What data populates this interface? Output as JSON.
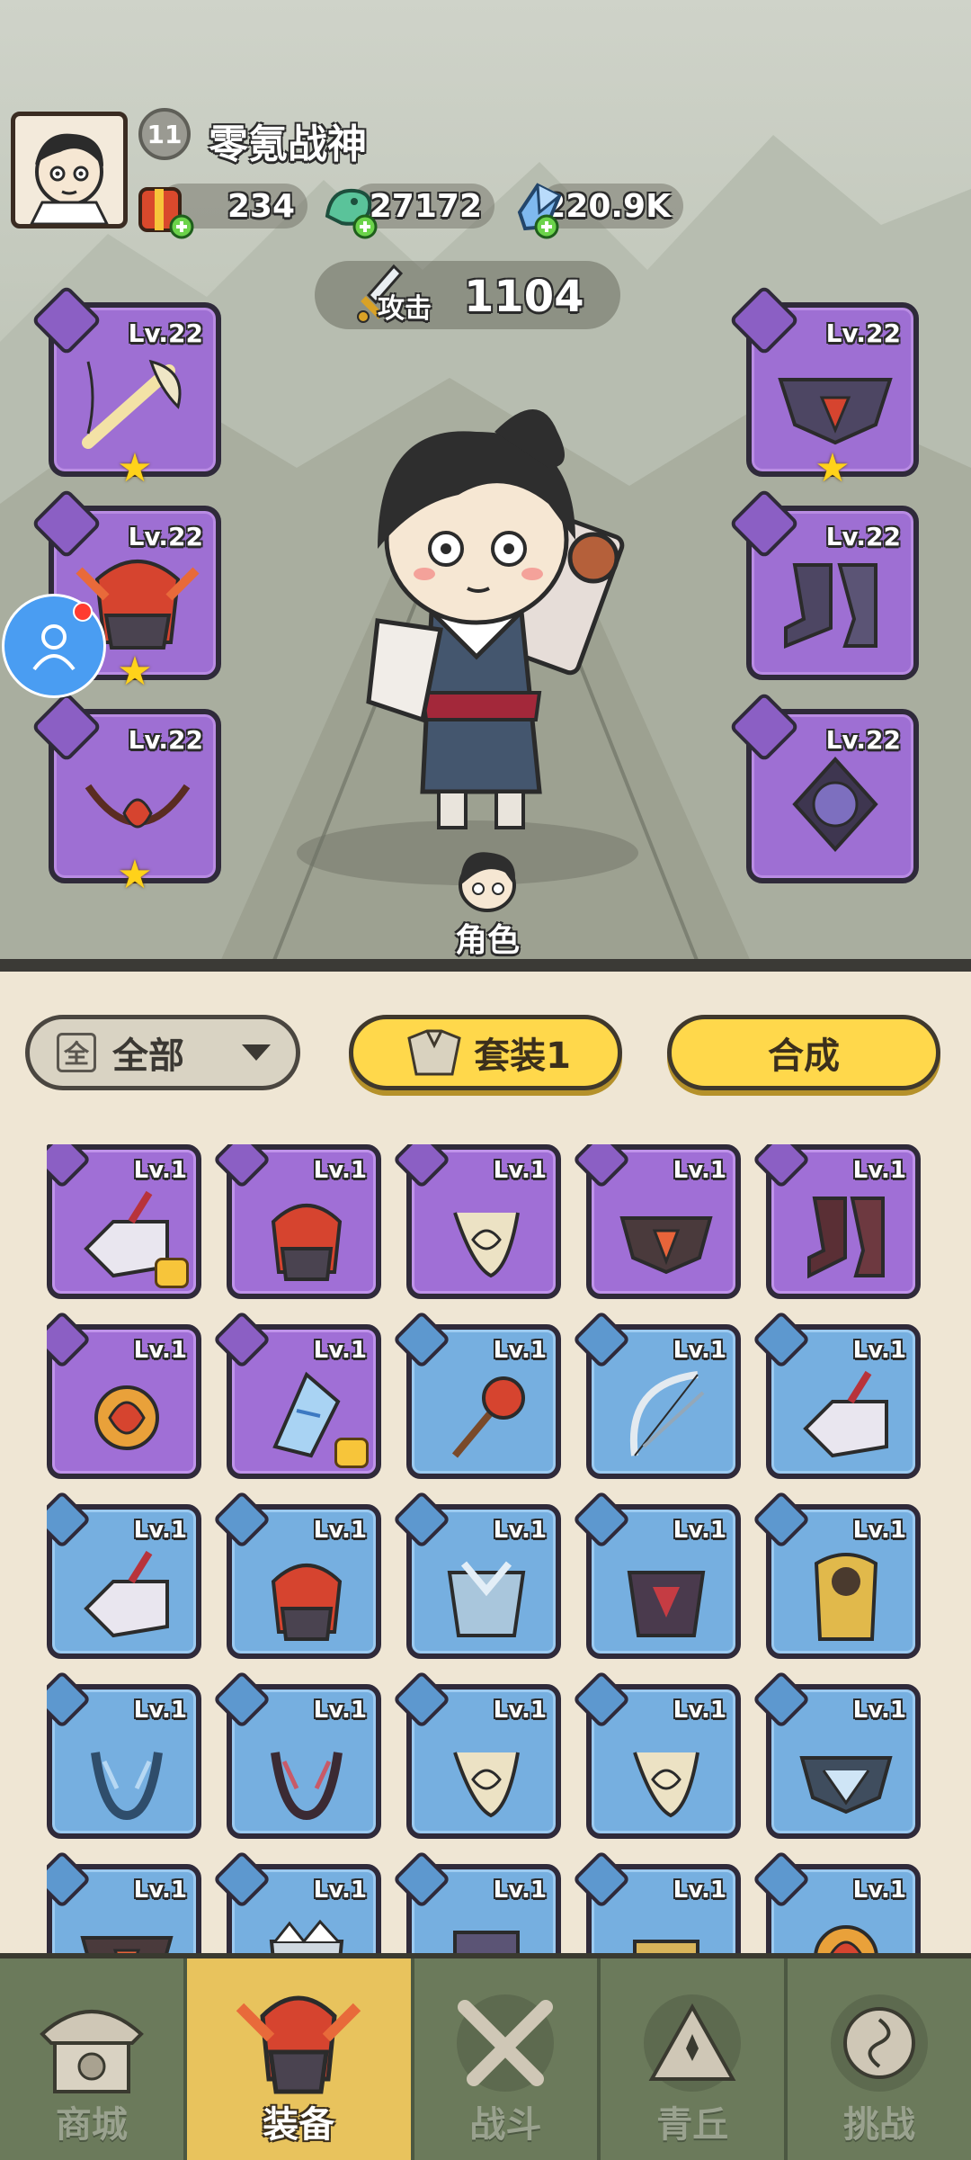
{
  "player": {
    "level": "11",
    "name": "零氪战神"
  },
  "resources": [
    {
      "name": "gift-pack",
      "value": "234"
    },
    {
      "name": "jade-dragon",
      "value": "27172"
    },
    {
      "name": "crystal",
      "value": "220.9K"
    }
  ],
  "power": {
    "label": "攻击",
    "value": "1104"
  },
  "equipped_left": [
    {
      "slot": "weapon",
      "level": "Lv.22",
      "star": "★"
    },
    {
      "slot": "helmet",
      "level": "Lv.22",
      "star": "★"
    },
    {
      "slot": "necklace",
      "level": "Lv.22",
      "star": "★"
    }
  ],
  "equipped_right": [
    {
      "slot": "belt",
      "level": "Lv.22",
      "star": "★"
    },
    {
      "slot": "boots",
      "level": "Lv.22",
      "star": ""
    },
    {
      "slot": "ring",
      "level": "Lv.22",
      "star": ""
    }
  ],
  "role_label": "角色",
  "filter": {
    "icon": "全",
    "label": "全部"
  },
  "set_button": "套装1",
  "craft_button": "合成",
  "inventory": [
    {
      "rarity": "purple",
      "level": "Lv.1",
      "item": "bracer",
      "mark": true
    },
    {
      "rarity": "purple",
      "level": "Lv.1",
      "item": "helmet",
      "mark": false
    },
    {
      "rarity": "purple",
      "level": "Lv.1",
      "item": "necklace",
      "mark": false
    },
    {
      "rarity": "purple",
      "level": "Lv.1",
      "item": "belt",
      "mark": false
    },
    {
      "rarity": "purple",
      "level": "Lv.1",
      "item": "boots",
      "mark": false
    },
    {
      "rarity": "purple",
      "level": "Lv.1",
      "item": "ring",
      "mark": false
    },
    {
      "rarity": "purple",
      "level": "Lv.1",
      "item": "pendant",
      "mark": true
    },
    {
      "rarity": "blue",
      "level": "Lv.1",
      "item": "weapon-mace",
      "mark": false
    },
    {
      "rarity": "blue",
      "level": "Lv.1",
      "item": "weapon-bow",
      "mark": false
    },
    {
      "rarity": "blue",
      "level": "Lv.1",
      "item": "bracer",
      "mark": false
    },
    {
      "rarity": "blue",
      "level": "Lv.1",
      "item": "bracer",
      "mark": false
    },
    {
      "rarity": "blue",
      "level": "Lv.1",
      "item": "helmet",
      "mark": false
    },
    {
      "rarity": "blue",
      "level": "Lv.1",
      "item": "armor-ice",
      "mark": false
    },
    {
      "rarity": "blue",
      "level": "Lv.1",
      "item": "armor-dark",
      "mark": false
    },
    {
      "rarity": "blue",
      "level": "Lv.1",
      "item": "armor-gold",
      "mark": false
    },
    {
      "rarity": "blue",
      "level": "Lv.1",
      "item": "necklace-ice",
      "mark": false
    },
    {
      "rarity": "blue",
      "level": "Lv.1",
      "item": "necklace-dark",
      "mark": false
    },
    {
      "rarity": "blue",
      "level": "Lv.1",
      "item": "necklace",
      "mark": false
    },
    {
      "rarity": "blue",
      "level": "Lv.1",
      "item": "necklace",
      "mark": false
    },
    {
      "rarity": "blue",
      "level": "Lv.1",
      "item": "belt-ice",
      "mark": false
    },
    {
      "rarity": "blue",
      "level": "Lv.1",
      "item": "belt",
      "mark": false
    },
    {
      "rarity": "blue",
      "level": "Lv.1",
      "item": "boots-ice",
      "mark": false
    },
    {
      "rarity": "blue",
      "level": "Lv.1",
      "item": "boots-dark",
      "mark": false
    },
    {
      "rarity": "blue",
      "level": "Lv.1",
      "item": "boots-gold",
      "mark": false
    },
    {
      "rarity": "blue",
      "level": "Lv.1",
      "item": "ring",
      "mark": false
    }
  ],
  "nav": [
    {
      "label": "商城",
      "icon": "shop-icon",
      "active": false
    },
    {
      "label": "装备",
      "icon": "equipment-icon",
      "active": true
    },
    {
      "label": "战斗",
      "icon": "battle-icon",
      "active": false
    },
    {
      "label": "青丘",
      "icon": "mountain-icon",
      "active": false
    },
    {
      "label": "挑战",
      "icon": "challenge-icon",
      "active": false
    }
  ],
  "colors": {
    "purple": "#a06fd6",
    "blue": "#76afe0",
    "accent": "#ffd84b",
    "nav_active": "#e8c35d"
  }
}
